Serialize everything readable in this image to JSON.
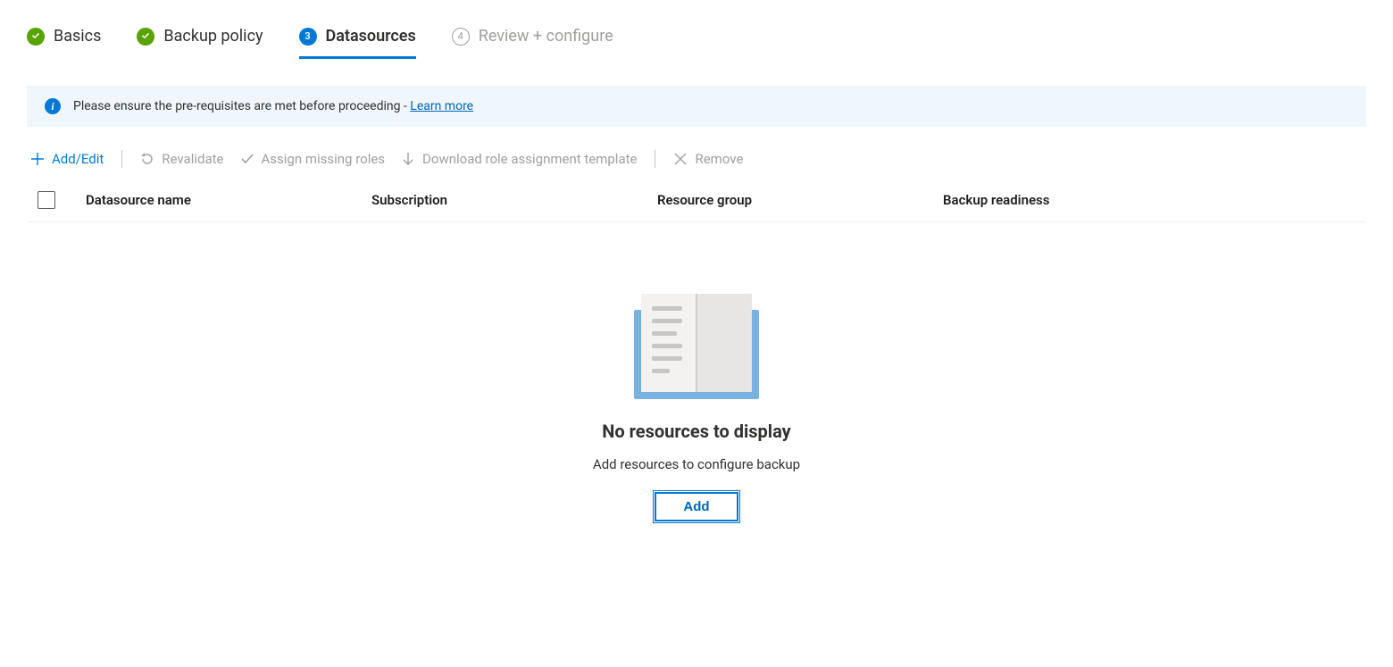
{
  "stepper": {
    "steps": [
      {
        "label": "Basics",
        "state": "done"
      },
      {
        "label": "Backup policy",
        "state": "done"
      },
      {
        "label": "Datasources",
        "state": "current",
        "number": "3"
      },
      {
        "label": "Review + configure",
        "state": "pending",
        "number": "4"
      }
    ]
  },
  "info_banner": {
    "text": "Please ensure the pre-requisites are met before proceeding - ",
    "link_label": "Learn more"
  },
  "commands": {
    "add_edit": "Add/Edit",
    "revalidate": "Revalidate",
    "assign_roles": "Assign missing roles",
    "download_template": "Download role assignment template",
    "remove": "Remove"
  },
  "table": {
    "columns": {
      "name": "Datasource name",
      "subscription": "Subscription",
      "resource_group": "Resource group",
      "backup_readiness": "Backup readiness"
    },
    "rows": []
  },
  "empty_state": {
    "title": "No resources to display",
    "subtitle": "Add resources to configure backup",
    "button": "Add"
  }
}
